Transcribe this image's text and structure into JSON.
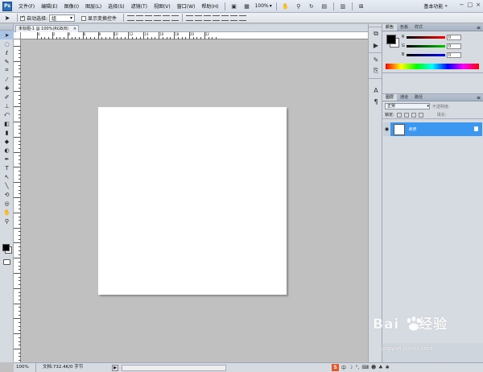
{
  "app": {
    "logo": "Ps"
  },
  "menubar": {
    "items": [
      "文件(F)",
      "编辑(E)",
      "图像(I)",
      "图层(L)",
      "选择(S)",
      "滤镜(T)",
      "视图(V)",
      "窗口(W)",
      "帮助(H)"
    ],
    "zoom": "100%",
    "workspace": "基本功能"
  },
  "options": {
    "auto_select_label": "自动选择:",
    "auto_select_value": "组",
    "show_transform_label": "显示变换控件"
  },
  "document": {
    "tab_title": "未标题-1 @ 100%(RGB/8)",
    "ruler_labels": [
      "0",
      "2",
      "4",
      "6",
      "8",
      "10",
      "12",
      "14",
      "16",
      "18",
      "20",
      "22"
    ]
  },
  "status": {
    "zoom": "100%",
    "info": "文档:732.4K/0 字节"
  },
  "color_panel": {
    "tabs": [
      "颜色",
      "色板",
      "样式"
    ],
    "channels": [
      {
        "label": "R",
        "value": "0"
      },
      {
        "label": "G",
        "value": "0"
      },
      {
        "label": "B",
        "value": "0"
      }
    ]
  },
  "layers_panel": {
    "tabs": [
      "图层",
      "通道",
      "路径"
    ],
    "blend_mode": "正常",
    "opacity_label": "不透明度:",
    "lock_label": "锁定:",
    "fill_label": "填充:",
    "layer_name": "背景"
  },
  "watermark": {
    "brand": "Bai",
    "brand2": "经验",
    "url": "jingyan.baidu.com"
  },
  "taskbar": {
    "ime": "中"
  }
}
